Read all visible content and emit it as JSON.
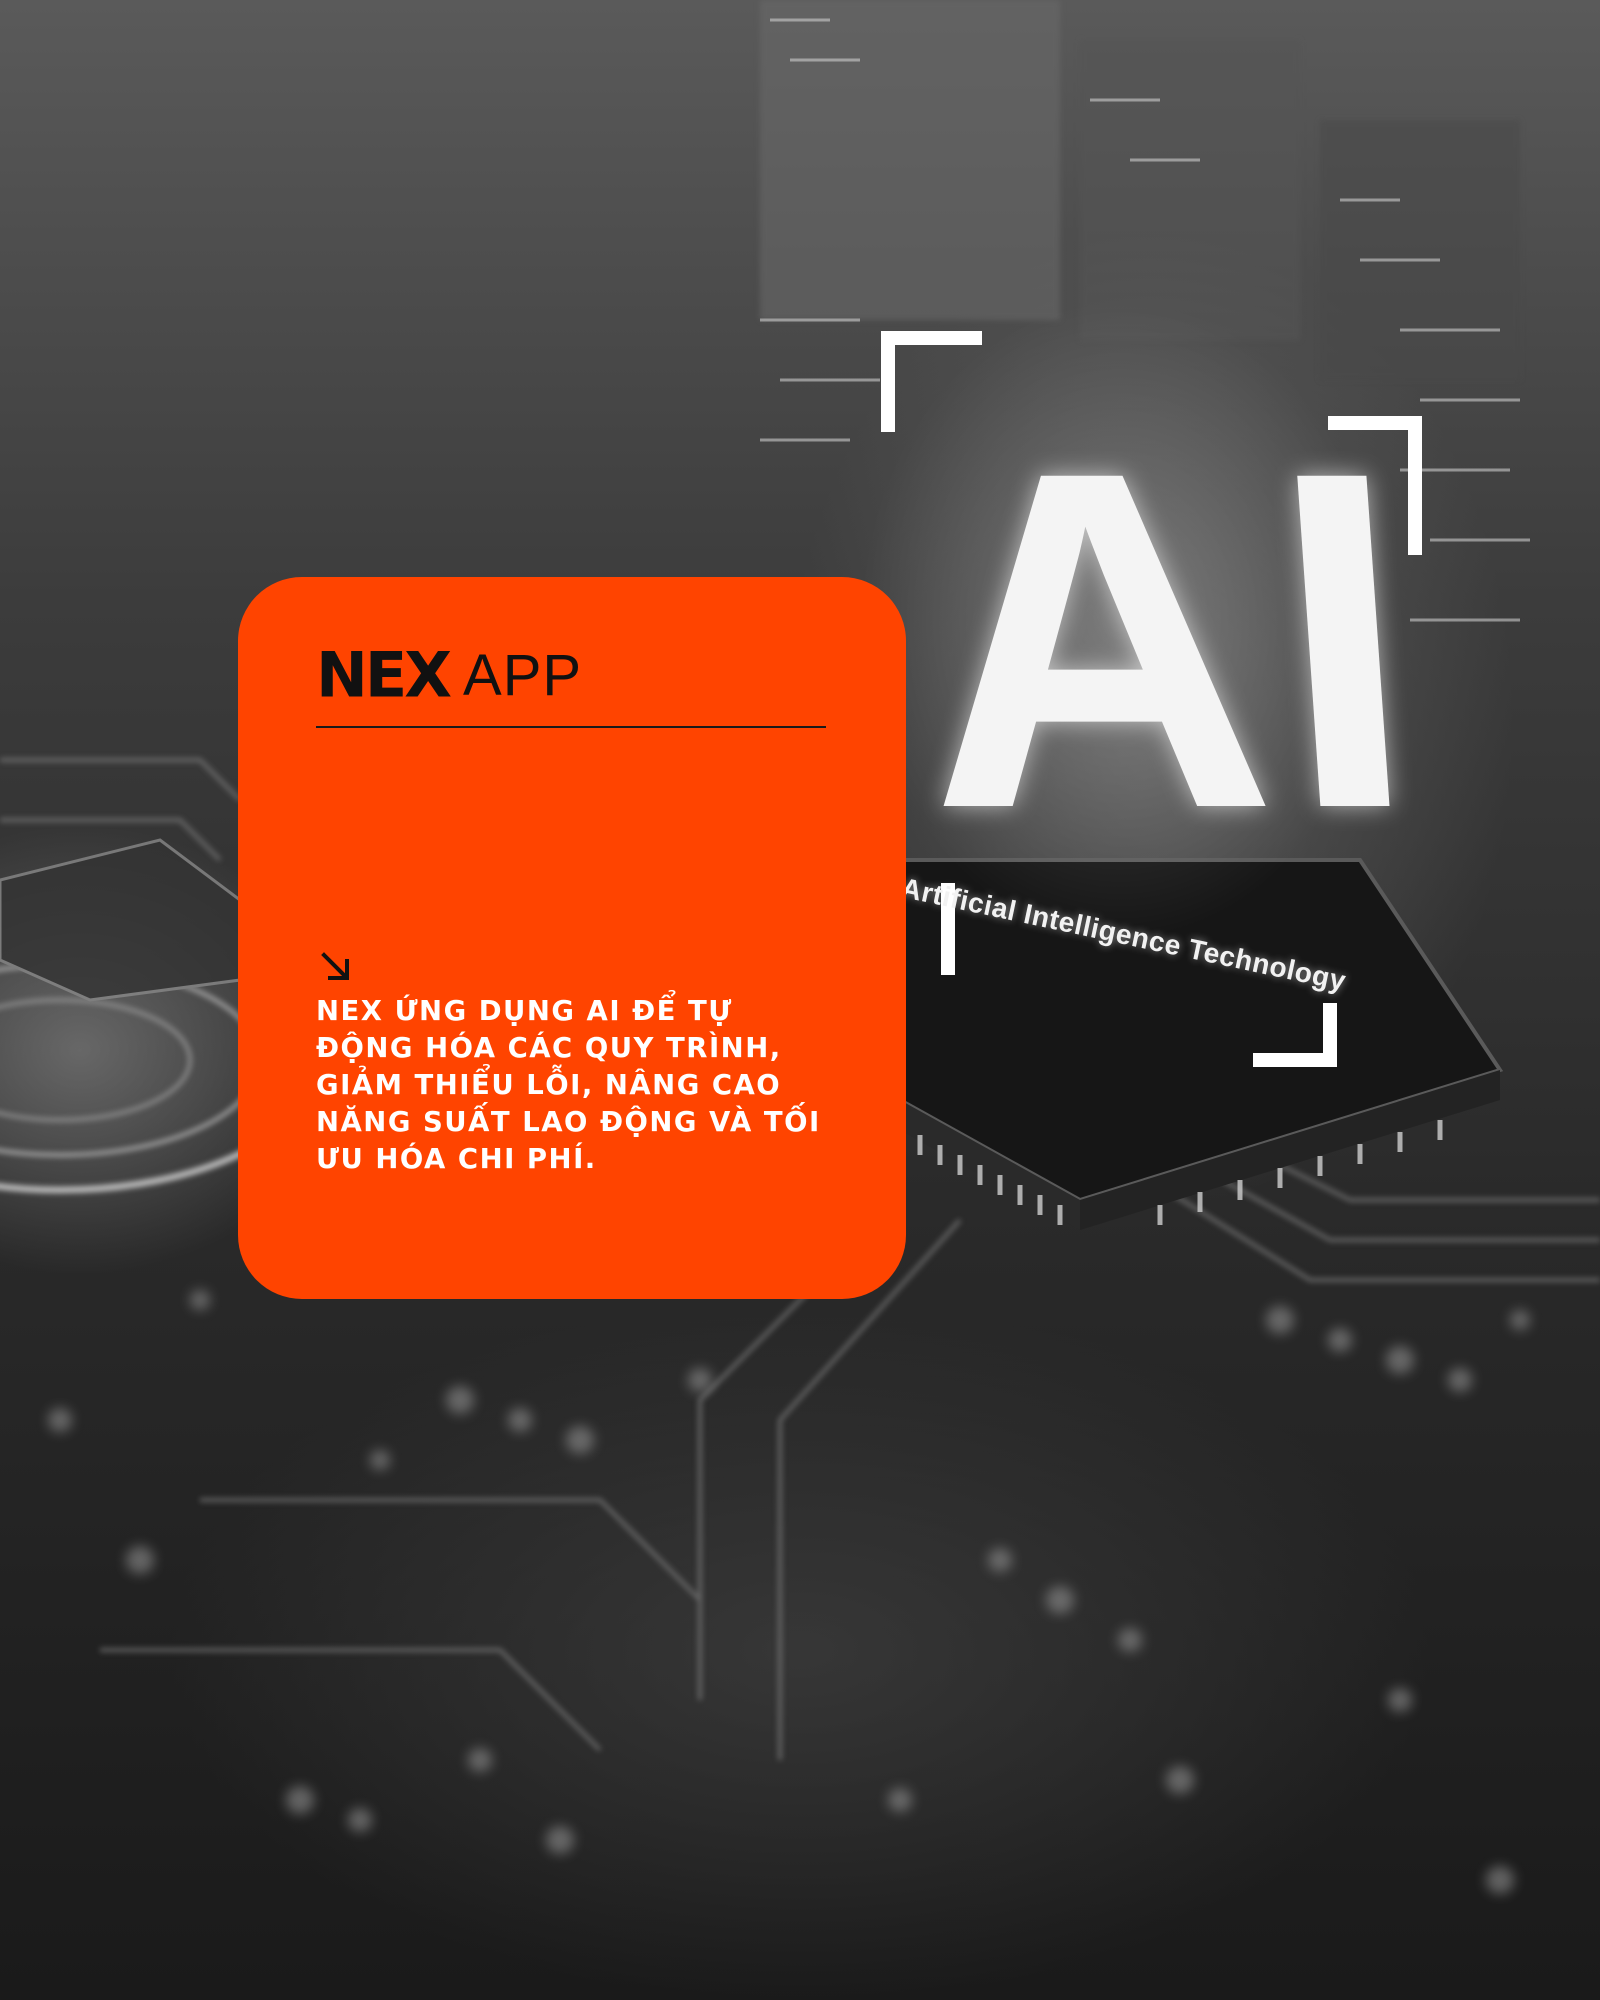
{
  "background": {
    "hero_letters": "AI",
    "chip_label": "Artificial Intelligence Technology"
  },
  "card": {
    "accent_color": "#ff4400",
    "logo": {
      "bold": "NEX",
      "light": "APP"
    },
    "arrow_icon": "arrow-down-right-icon",
    "caption": "NEX ỨNG DỤNG AI ĐỂ TỰ ĐỘNG HÓA CÁC QUY TRÌNH, GIẢM THIỂU LỖI, NÂNG CAO NĂNG SUẤT LAO ĐỘNG VÀ TỐI ƯU HÓA CHI PHÍ."
  }
}
